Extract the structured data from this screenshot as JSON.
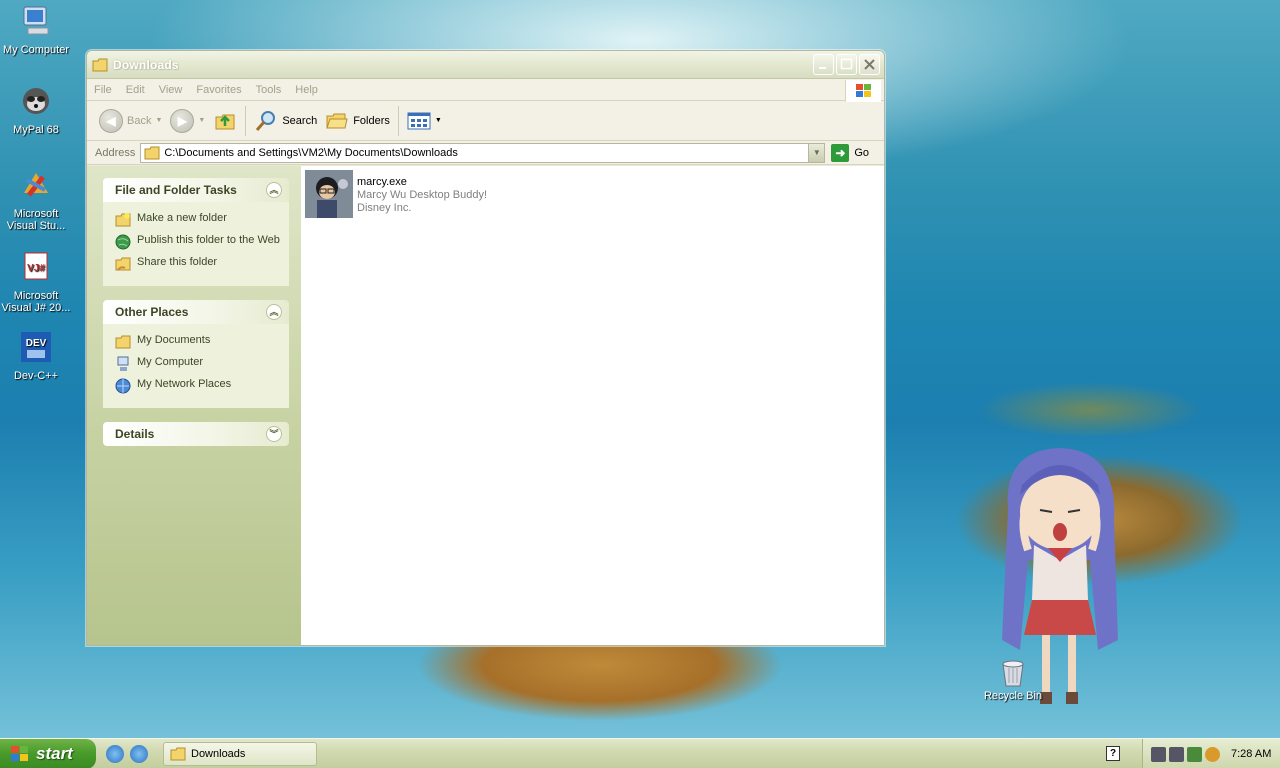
{
  "desktop": {
    "icons": [
      {
        "label": "My Computer"
      },
      {
        "label": "MyPal 68"
      },
      {
        "label": "Microsoft Visual Stu..."
      },
      {
        "label": "Microsoft Visual J# 20..."
      },
      {
        "label": "Dev-C++"
      }
    ],
    "recycle_bin": "Recycle Bin"
  },
  "window": {
    "title": "Downloads",
    "menu": [
      "File",
      "Edit",
      "View",
      "Favorites",
      "Tools",
      "Help"
    ],
    "toolbar": {
      "back": "Back",
      "search": "Search",
      "folders": "Folders"
    },
    "address": {
      "label": "Address",
      "value": "C:\\Documents and Settings\\VM2\\My Documents\\Downloads",
      "go": "Go"
    },
    "tasks_panel": {
      "title": "File and Folder Tasks",
      "items": [
        "Make a new folder",
        "Publish this folder to the Web",
        "Share this folder"
      ]
    },
    "places_panel": {
      "title": "Other Places",
      "items": [
        "My Documents",
        "My Computer",
        "My Network Places"
      ]
    },
    "details_panel": {
      "title": "Details"
    },
    "files": [
      {
        "name": "marcy.exe",
        "description": "Marcy Wu Desktop Buddy!",
        "company": "Disney Inc."
      }
    ]
  },
  "taskbar": {
    "start": "start",
    "task_item": "Downloads",
    "clock": "7:28 AM"
  },
  "colors": {
    "start_green": "#479a2a",
    "window_chrome": "#ece9d8",
    "leftpane": "#c7d2a3"
  }
}
